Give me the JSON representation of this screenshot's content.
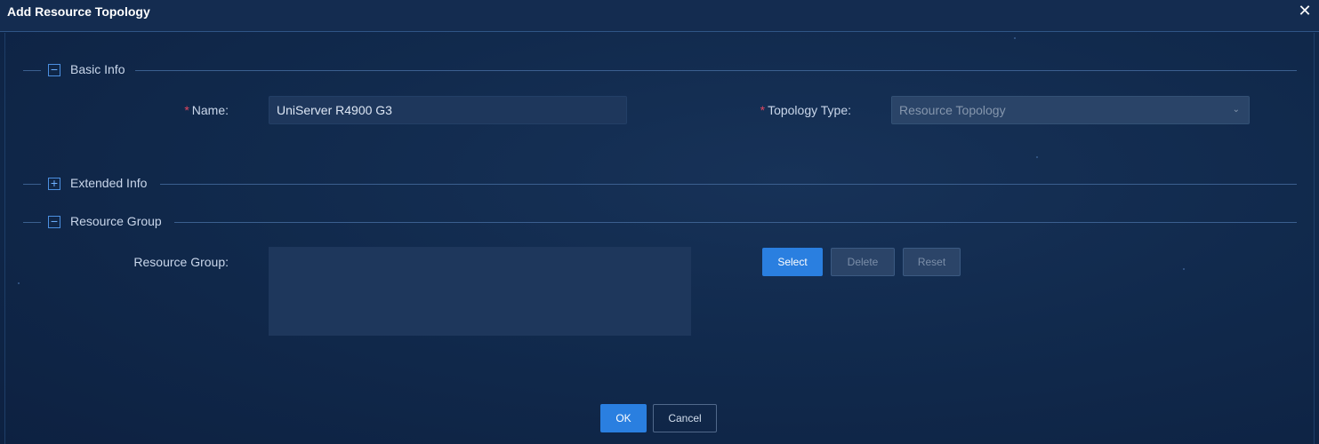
{
  "dialog": {
    "title": "Add Resource Topology",
    "close_label": "✕"
  },
  "sections": {
    "basic_info": {
      "label": "Basic Info",
      "toggle": "−"
    },
    "extended_info": {
      "label": "Extended Info",
      "toggle": "+"
    },
    "resource_group": {
      "label": "Resource Group",
      "toggle": "−"
    }
  },
  "fields": {
    "required_mark": "*",
    "name": {
      "label": "Name:",
      "value": "UniServer R4900 G3"
    },
    "topology_type": {
      "label": "Topology Type:",
      "value": "Resource Topology",
      "chevron": "⌄"
    },
    "resource_group": {
      "label": "Resource Group:",
      "value": ""
    }
  },
  "buttons": {
    "select": "Select",
    "delete": "Delete",
    "reset": "Reset",
    "ok": "OK",
    "cancel": "Cancel"
  },
  "icons": {
    "close": "close-icon",
    "collapse": "minus-icon",
    "expand": "plus-icon",
    "dropdown": "chevron-down-icon"
  },
  "colors": {
    "primary": "#2a7fe0",
    "required": "#e0465e",
    "background": "#112a4d"
  }
}
